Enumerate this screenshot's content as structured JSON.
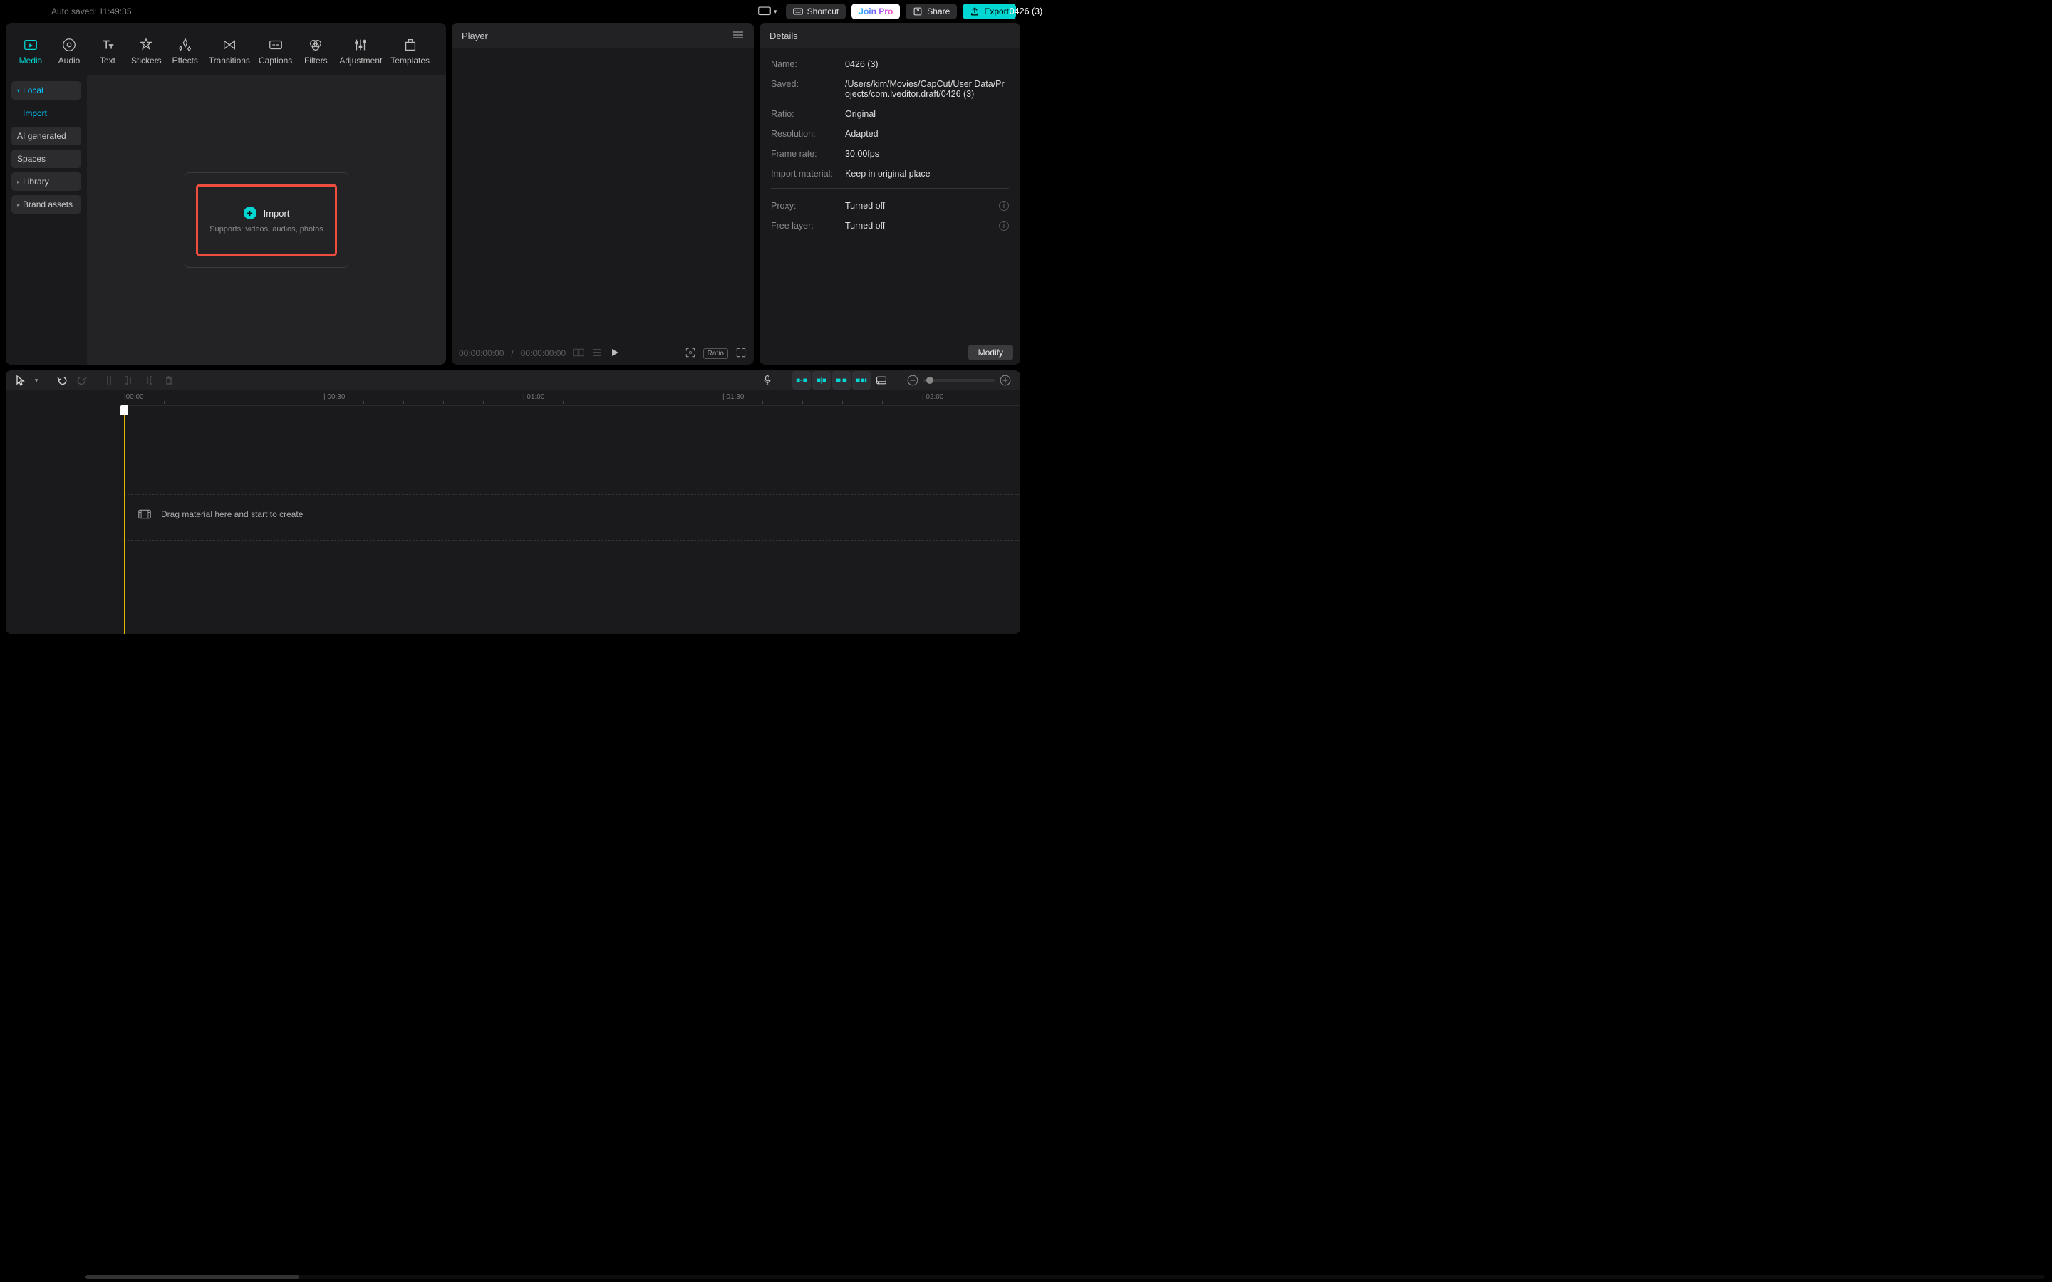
{
  "topbar": {
    "autosave": "Auto saved: 11:49:35",
    "title": "0426 (3)",
    "shortcut": "Shortcut",
    "joinpro": "Join Pro",
    "share": "Share",
    "export": "Export"
  },
  "assetTabs": [
    {
      "label": "Media"
    },
    {
      "label": "Audio"
    },
    {
      "label": "Text"
    },
    {
      "label": "Stickers"
    },
    {
      "label": "Effects"
    },
    {
      "label": "Transitions"
    },
    {
      "label": "Captions"
    },
    {
      "label": "Filters"
    },
    {
      "label": "Adjustment"
    },
    {
      "label": "Templates"
    }
  ],
  "mediaSidebar": {
    "local": "Local",
    "import": "Import",
    "ai": "AI generated",
    "spaces": "Spaces",
    "library": "Library",
    "brand": "Brand assets"
  },
  "importCard": {
    "title": "Import",
    "sub": "Supports: videos, audios, photos"
  },
  "player": {
    "title": "Player",
    "t1": "00:00:00:00",
    "sep": "/",
    "t2": "00:00:00:00",
    "ratio": "Ratio"
  },
  "details": {
    "title": "Details",
    "rows": {
      "name_k": "Name:",
      "name_v": "0426 (3)",
      "saved_k": "Saved:",
      "saved_v": "/Users/kim/Movies/CapCut/User Data/Projects/com.lveditor.draft/0426 (3)",
      "ratio_k": "Ratio:",
      "ratio_v": "Original",
      "res_k": "Resolution:",
      "res_v": "Adapted",
      "fps_k": "Frame rate:",
      "fps_v": "30.00fps",
      "imp_k": "Import material:",
      "imp_v": "Keep in original place",
      "proxy_k": "Proxy:",
      "proxy_v": "Turned off",
      "free_k": "Free layer:",
      "free_v": "Turned off"
    },
    "modify": "Modify"
  },
  "ruler": {
    "m0": "|00:00",
    "m1": "| 00:30",
    "m2": "| 01:00",
    "m3": "| 01:30",
    "m4": "| 02:00"
  },
  "timeline": {
    "hint": "Drag material here and start to create"
  }
}
